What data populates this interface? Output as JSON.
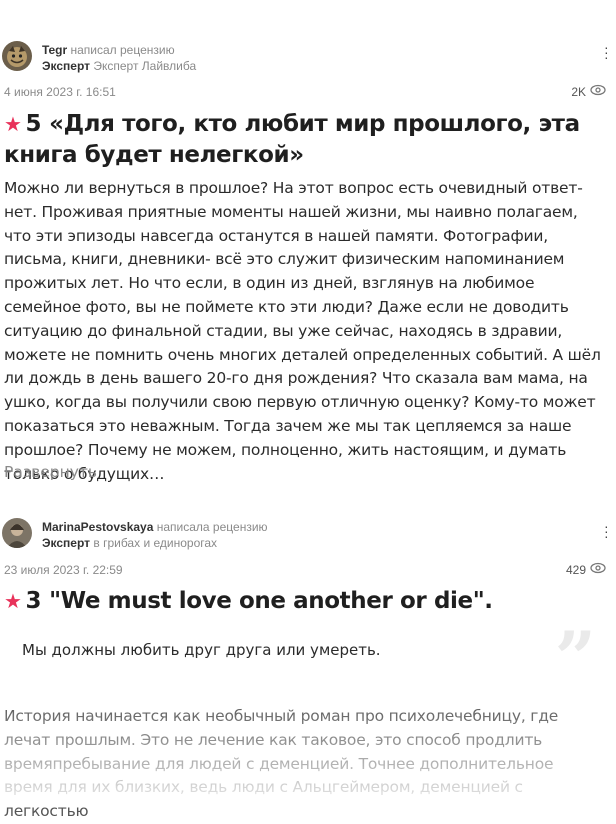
{
  "reviews": [
    {
      "author": "Tegr",
      "action": "написал рецензию",
      "badge": "Эксперт",
      "badge_topic": "Эксперт Лайвлиба",
      "date": "4 июня 2023 г. 16:51",
      "views": "2K",
      "rating": "5",
      "title": "«Для того, кто любит мир прошлого, эта книга будет нелегкой»",
      "body": "Можно ли вернуться в прошлое? На этот вопрос есть очевидный ответ- нет. Проживая приятные моменты нашей жизни, мы наивно полагаем, что эти эпизоды навсегда останутся в нашей памяти. Фотографии, письма, книги, дневники- всё это служит физическим напоминанием прожитых лет. Но что если, в один из дней, взглянув на любимое семейное фото, вы не поймете кто эти люди? Даже если не доводить ситуацию до финальной стадии, вы уже сейчас, находясь в здравии, можете не помнить очень многих деталей определенных событий. А шёл ли дождь в день вашего 20-го дня рождения? Что сказала вам мама, на ушко, когда вы получили свою первую отличную оценку? Кому-то может показаться это неважным. Тогда зачем же мы так цепляемся за наше прошлое? Почему не можем, полноценно, жить настоящим, и думать только о будущих…",
      "expand": "Развернуть"
    },
    {
      "author": "MarinaPestovskaya",
      "action": "написала рецензию",
      "badge": "Эксперт",
      "badge_topic": "в грибах и единорогах",
      "date": "23 июля 2023 г. 22:59",
      "views": "429",
      "rating": "3",
      "title": "\"We must love one another or die\".",
      "quote": "Мы должны любить друг друга или умереть.",
      "body": "История начинается как необычный роман про психолечебницу, где лечат прошлым. Это не лечение как таковое, это способ продлить времяпребывание для людей с деменцией. Точнее дополнительное время для их близких, ведь люди с Альцгеймером, деменцией с легкостью"
    }
  ],
  "colors": {
    "accent": "#e8325a",
    "muted": "#8a8a8a"
  },
  "icons": {
    "star": "star-icon",
    "eye": "eye-icon",
    "menu": "more-vertical-icon"
  }
}
